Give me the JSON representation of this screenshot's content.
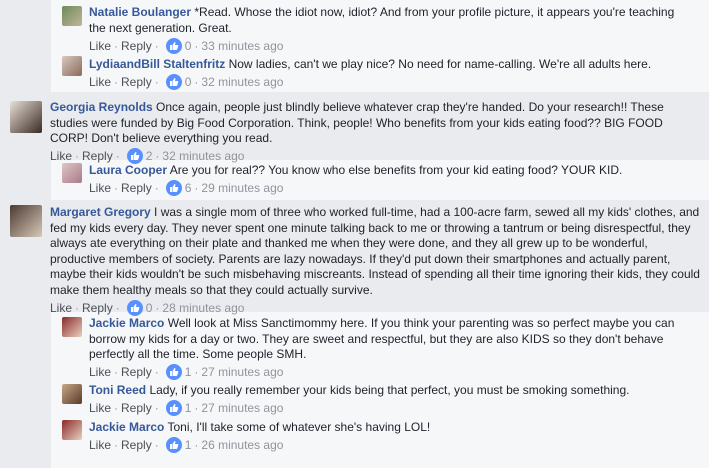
{
  "comments": [
    {
      "author": "Natalie Boulanger",
      "text": " *Read. Whose the idiot now, idiot? And from your profile picture, it appears you're teaching the next generation. Great.",
      "like": "Like",
      "reply": "Reply",
      "count": "0",
      "time": "33 minutes ago"
    },
    {
      "author": "LydiaandBill Staltenfritz",
      "text": " Now ladies, can't we play nice? No need for name-calling. We're all adults here.",
      "like": "Like",
      "reply": "Reply",
      "count": "0",
      "time": "32 minutes ago"
    },
    {
      "author": "Georgia Reynolds",
      "text": " Once again, people just blindly believe whatever crap they're handed. Do your research!! These studies were funded by Big Food Corporation. Think, people! Who benefits from your kids eating food?? BIG FOOD CORP! Don't believe everything you read.",
      "like": "Like",
      "reply": "Reply",
      "count": "2",
      "time": "32 minutes ago"
    },
    {
      "author": "Laura Cooper",
      "text": " Are you for real?? You know who else benefits from your kid eating food? YOUR KID.",
      "like": "Like",
      "reply": "Reply",
      "count": "6",
      "time": "29 minutes ago"
    },
    {
      "author": "Margaret Gregory",
      "text": " I was a single mom of three who worked full-time, had a 100-acre farm, sewed all my kids' clothes, and fed my kids every day. They never spent one minute talking back to me or throwing a tantrum or being disrespectful, they always ate everything on their plate and thanked me when they were done, and they all grew up to be wonderful, productive members of society. Parents are lazy nowadays. If they'd put down their smartphones and actually parent, maybe their kids wouldn't be such misbehaving miscreants. Instead of spending all their time ignoring their kids, they could make them healthy meals so that they could actually survive.",
      "like": "Like",
      "reply": "Reply",
      "count": "0",
      "time": "28 minutes ago"
    },
    {
      "author": "Jackie Marco",
      "text": " Well look at Miss Sanctimommy here. If you think your parenting was so perfect maybe you can borrow my kids for a day or two. They are sweet and respectful, but they are also KIDS so they don't behave perfectly all the time. Some people SMH.",
      "like": "Like",
      "reply": "Reply",
      "count": "1",
      "time": "27 minutes ago"
    },
    {
      "author": "Toni Reed",
      "text": " Lady, if you really remember your kids being that perfect, you must be smoking something.",
      "like": "Like",
      "reply": "Reply",
      "count": "1",
      "time": "27 minutes ago"
    },
    {
      "author": "Jackie Marco",
      "text": " Toni, I'll take some of whatever she's having LOL!",
      "like": "Like",
      "reply": "Reply",
      "count": "1",
      "time": "26 minutes ago"
    }
  ],
  "separator": "·"
}
